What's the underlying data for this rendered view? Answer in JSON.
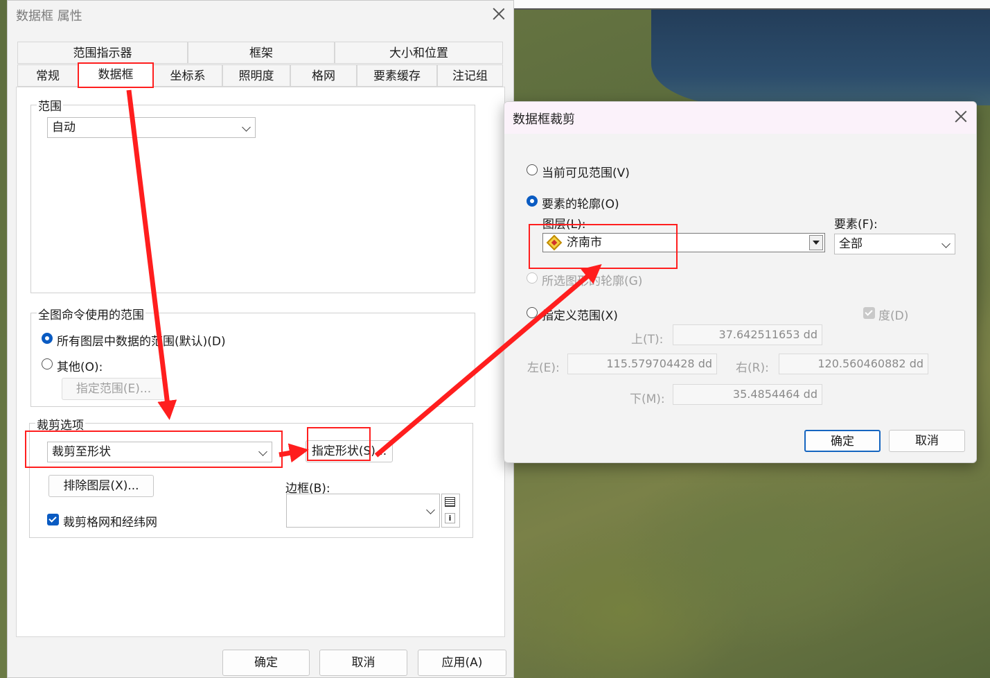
{
  "main_dialog": {
    "title": "数据框 属性",
    "tabs_row1": [
      "范围指示器",
      "框架",
      "大小和位置"
    ],
    "tabs_row2": [
      "常规",
      "数据框",
      "坐标系",
      "照明度",
      "格网",
      "要素缓存",
      "注记组"
    ],
    "active_tab": "数据框",
    "extent": {
      "group_label": "范围",
      "combo_value": "自动"
    },
    "full_extent": {
      "group_label": "全图命令使用的范围",
      "option_default": "所有图层中数据的范围(默认)(D)",
      "option_other": "其他(O):",
      "specify_button": "指定范围(E)..."
    },
    "clip": {
      "group_label": "裁剪选项",
      "combo_value": "裁剪至形状",
      "specify_shape_button": "指定形状(S)...",
      "exclude_button": "排除图层(X)...",
      "border_label": "边框(B):",
      "clip_grid_label": "裁剪格网和经纬网"
    },
    "buttons": {
      "ok": "确定",
      "cancel": "取消",
      "apply": "应用(A)"
    }
  },
  "clip_dialog": {
    "title": "数据框裁剪",
    "option_visible": "当前可见范围(V)",
    "option_outline": "要素的轮廓(O)",
    "layer_label": "图层(L):",
    "layer_value": "济南市",
    "feature_label": "要素(F):",
    "feature_value": "全部",
    "option_selected": "所选图形的轮廓(G)",
    "option_custom": "指定义范围(X)",
    "degree_label": "度(D)",
    "top_label": "上(T):",
    "top_value": "37.642511653 dd",
    "left_label": "左(E):",
    "left_value": "115.579704428 dd",
    "right_label": "右(R):",
    "right_value": "120.560460882 dd",
    "bottom_label": "下(M):",
    "bottom_value": "35.4854464 dd",
    "buttons": {
      "ok": "确定",
      "cancel": "取消"
    }
  },
  "colors": {
    "annotation_red": "#ff1e1e",
    "accent_blue": "#0a5bc2"
  }
}
